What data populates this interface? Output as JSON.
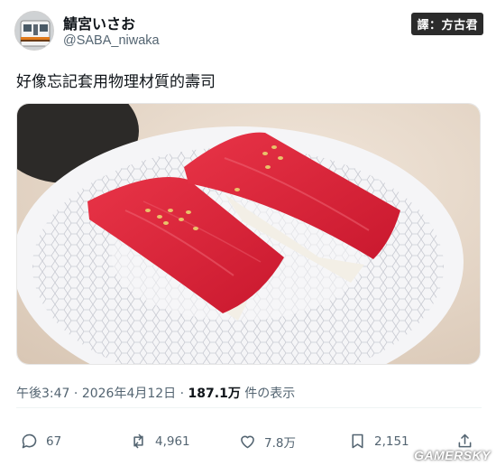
{
  "user": {
    "display_name": "鯖宮いさお",
    "handle": "@SABA_niwaka"
  },
  "translator_badge": "譯：方古君",
  "tweet": {
    "text": "好像忘記套用物理材質的壽司"
  },
  "meta": {
    "time": "午後3:47",
    "sep1": " · ",
    "date": "2026年4月12日",
    "sep2": " · ",
    "views": "187.1万",
    "views_suffix": " 件の表示"
  },
  "actions": {
    "replies": "67",
    "reposts": "4,961",
    "likes": "7.8万",
    "bookmarks": "2,151"
  },
  "watermark": "GAMERSKY",
  "colors": {
    "text_primary": "#0f1419",
    "text_secondary": "#536471",
    "tuna": "#d8223a"
  }
}
